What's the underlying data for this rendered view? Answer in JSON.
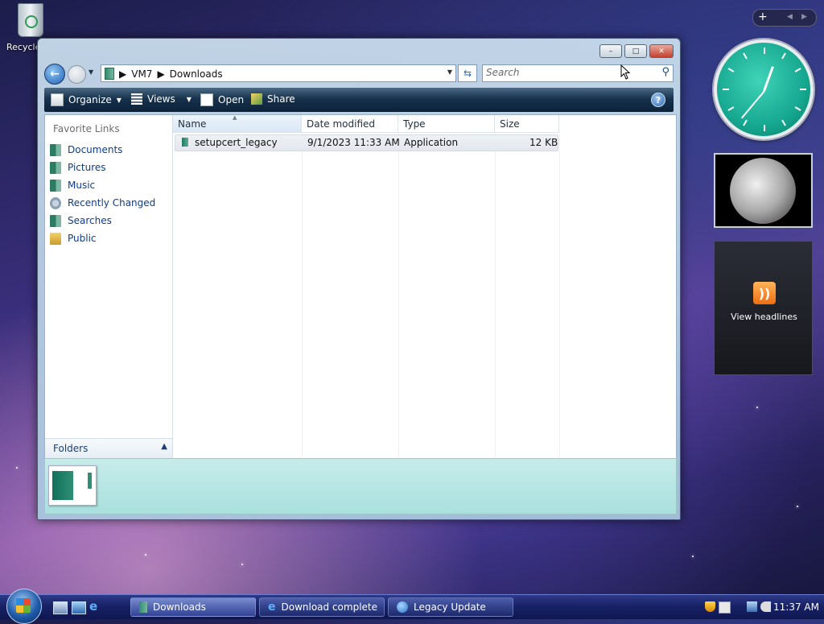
{
  "desktop": {
    "recycle_bin_label": "Recycle"
  },
  "window": {
    "caption_buttons": {
      "minimize": "–",
      "maximize": "□",
      "close": "✕"
    },
    "breadcrumb": [
      "VM7",
      "Downloads"
    ],
    "search_placeholder": "Search",
    "toolbar": {
      "organize": "Organize",
      "views": "Views",
      "open": "Open",
      "share": "Share"
    },
    "nav_pane": {
      "heading": "Favorite Links",
      "items": [
        {
          "label": "Documents",
          "icon": "documents-icon"
        },
        {
          "label": "Pictures",
          "icon": "pictures-icon"
        },
        {
          "label": "Music",
          "icon": "music-icon"
        },
        {
          "label": "Recently Changed",
          "icon": "recently-changed-icon"
        },
        {
          "label": "Searches",
          "icon": "searches-icon"
        },
        {
          "label": "Public",
          "icon": "public-folder-icon"
        }
      ],
      "folders_label": "Folders"
    },
    "columns": [
      "Name",
      "Date modified",
      "Type",
      "Size"
    ],
    "files": [
      {
        "name": "setupcert_legacy",
        "date_modified": "9/1/2023 11:33 AM",
        "type": "Application",
        "size": "12 KB"
      }
    ]
  },
  "gadgets": {
    "feed_text": "View headlines"
  },
  "taskbar": {
    "tasks": [
      {
        "label": "Downloads",
        "icon": "folder-icon",
        "active": true
      },
      {
        "label": "Download complete",
        "icon": "ie-icon",
        "active": false
      },
      {
        "label": "Legacy Update",
        "icon": "legacy-update-icon",
        "active": false
      }
    ],
    "clock": "11:37 AM"
  },
  "colors": {
    "taskbar": "#182266",
    "toolbar": "#17324c",
    "link": "#0b3d91",
    "details_pane": "#b9e6e4",
    "clock_face": "#16a890"
  }
}
